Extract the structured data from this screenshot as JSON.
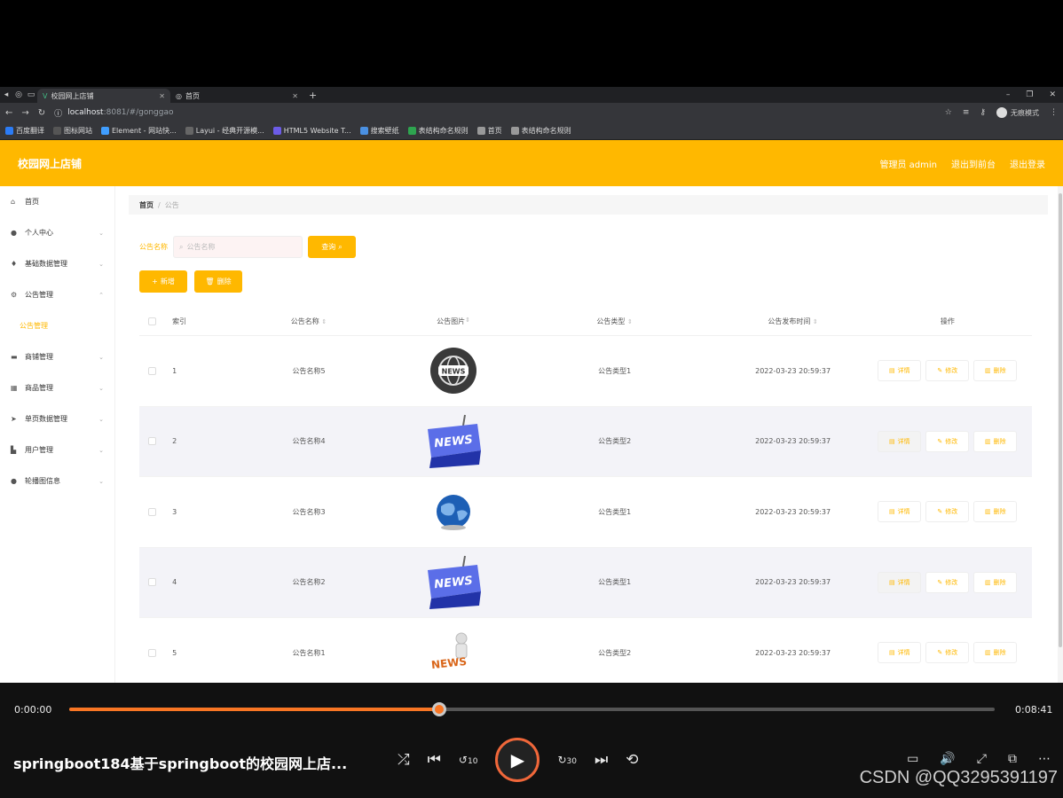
{
  "browser": {
    "tabs": [
      {
        "label": "校园网上店铺",
        "active": true
      },
      {
        "label": "首页",
        "active": false
      }
    ],
    "url_host": "localhost",
    "url_path": ":8081/#/gonggao",
    "profile_label": "无痕模式",
    "bookmarks": [
      "百度翻译",
      "图标网站",
      "Element - 网站快...",
      "Layui - 经典开源模...",
      "HTML5 Website T...",
      "搜索壁纸",
      "表结构命名规则",
      "首页",
      "表结构命名规则"
    ]
  },
  "header": {
    "title": "校园网上店铺",
    "admin": "管理员 admin",
    "front": "退出到前台",
    "logout": "退出登录"
  },
  "sidebar": {
    "items": [
      {
        "label": "首页",
        "icon": "home-icon"
      },
      {
        "label": "个人中心",
        "icon": "user-icon"
      },
      {
        "label": "基础数据管理",
        "icon": "mic-icon"
      },
      {
        "label": "公告管理",
        "icon": "settings-icon"
      },
      {
        "label": "公告管理",
        "icon": ""
      },
      {
        "label": "商铺管理",
        "icon": "shop-icon"
      },
      {
        "label": "商品管理",
        "icon": "grid-icon"
      },
      {
        "label": "单页数据管理",
        "icon": "send-icon"
      },
      {
        "label": "用户管理",
        "icon": "users-icon"
      },
      {
        "label": "轮播图信息",
        "icon": "pin-icon"
      }
    ]
  },
  "breadcrumb": {
    "home": "首页",
    "sep": "/",
    "current": "公告"
  },
  "filter": {
    "label": "公告名称",
    "placeholder": "公告名称",
    "search": "查询"
  },
  "actions": {
    "add": "新增",
    "delete": "删除"
  },
  "table": {
    "headers": {
      "index": "索引",
      "name": "公告名称",
      "image": "公告图片",
      "type": "公告类型",
      "time": "公告发布时间",
      "ops": "操作"
    },
    "rows": [
      {
        "index": "1",
        "name": "公告名称5",
        "type": "公告类型1",
        "time": "2022-03-23 20:59:37"
      },
      {
        "index": "2",
        "name": "公告名称4",
        "type": "公告类型2",
        "time": "2022-03-23 20:59:37"
      },
      {
        "index": "3",
        "name": "公告名称3",
        "type": "公告类型1",
        "time": "2022-03-23 20:59:37"
      },
      {
        "index": "4",
        "name": "公告名称2",
        "type": "公告类型1",
        "time": "2022-03-23 20:59:37"
      },
      {
        "index": "5",
        "name": "公告名称1",
        "type": "公告类型2",
        "time": "2022-03-23 20:59:37"
      }
    ],
    "op_detail": "详情",
    "op_edit": "修改",
    "op_delete": "删除",
    "news_text": "NEWS"
  },
  "player": {
    "current": "0:00:00",
    "total": "0:08:41",
    "progress": 0.4,
    "title": "springboot184基于springboot的校园网上店...",
    "watermark": "CSDN @QQ3295391197",
    "skip_back": "10",
    "skip_fwd": "30"
  },
  "colors": {
    "accent": "#ffb800",
    "progress": "#f97624"
  }
}
